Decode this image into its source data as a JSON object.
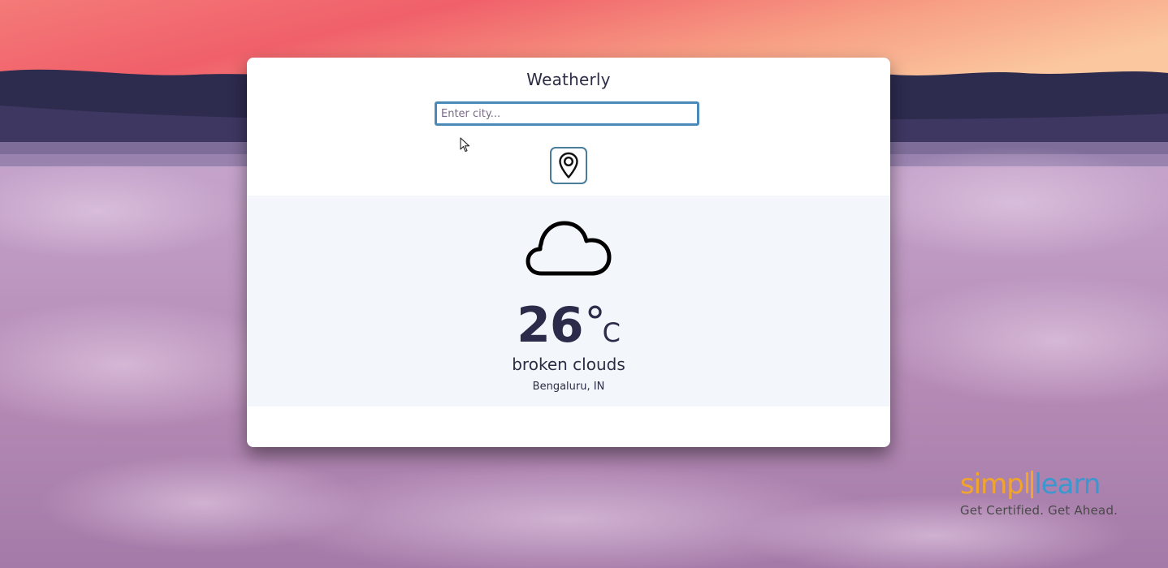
{
  "app": {
    "title": "Weatherly"
  },
  "search": {
    "placeholder": "Enter city...",
    "value": ""
  },
  "locate_button": {
    "icon": "map-pin-icon"
  },
  "weather": {
    "icon": "cloud-icon",
    "temperature": "26",
    "degree_symbol": "°",
    "unit": "C",
    "description": "broken clouds",
    "location": "Bengaluru, IN"
  },
  "brand": {
    "name_part1": "simpl",
    "name_part2": "learn",
    "tagline": "Get Certified. Get Ahead.",
    "colors": {
      "orange": "#f1a52c",
      "blue": "#3a97cf"
    }
  },
  "colors": {
    "accent": "#4a8ab8",
    "text": "#2c2c44",
    "panel": "#f3f7fb"
  }
}
